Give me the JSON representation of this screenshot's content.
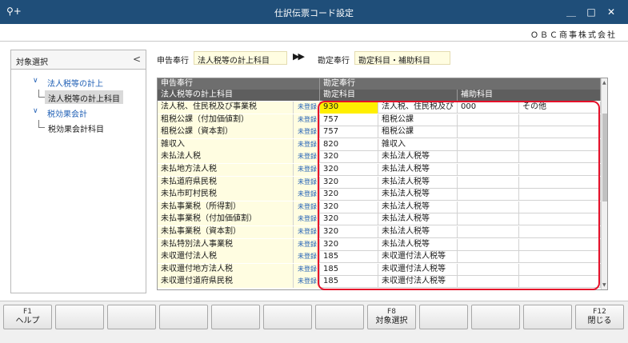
{
  "window": {
    "title": "仕訳伝票コード設定",
    "icon": "search-plus-icon",
    "controls": [
      "minimize-icon",
      "maximize-icon",
      "close-icon"
    ]
  },
  "company": "ＯＢＣ商事株式会社",
  "left_pane": {
    "title": "対象選択",
    "collapse_glyph": "<",
    "tree": [
      {
        "label": "法人税等の計上",
        "type": "parent"
      },
      {
        "label": "法人税等の計上科目",
        "type": "child",
        "selected": true
      },
      {
        "label": "税効果会計",
        "type": "parent"
      },
      {
        "label": "税効果会計科目",
        "type": "child",
        "selected": false
      }
    ]
  },
  "header": {
    "declaration_label": "申告奉行",
    "declaration_value": "法人税等の計上科目",
    "arrows": "▶▶",
    "kanjo_label": "勘定奉行",
    "kanjo_value": "勘定科目・補助科目"
  },
  "grid": {
    "top_headers": [
      "申告奉行",
      "勘定奉行"
    ],
    "sub_headers": [
      "法人税等の計上科目",
      "勘定科目",
      "補助科目"
    ],
    "unregistered_label": "未登録",
    "rows": [
      {
        "name": "法人税、住民税及び事業税",
        "reg": "未登録",
        "code": "930",
        "account": "法人税、住民税及び",
        "sub_code": "000",
        "sub_name": "その他"
      },
      {
        "name": "租税公課（付加価値割）",
        "reg": "未登録",
        "code": "757",
        "account": "租税公課",
        "sub_code": "",
        "sub_name": ""
      },
      {
        "name": "租税公課（資本割）",
        "reg": "未登録",
        "code": "757",
        "account": "租税公課",
        "sub_code": "",
        "sub_name": ""
      },
      {
        "name": "雑収入",
        "reg": "未登録",
        "code": "820",
        "account": "雑収入",
        "sub_code": "",
        "sub_name": ""
      },
      {
        "name": "未払法人税",
        "reg": "未登録",
        "code": "320",
        "account": "未払法人税等",
        "sub_code": "",
        "sub_name": ""
      },
      {
        "name": "未払地方法人税",
        "reg": "未登録",
        "code": "320",
        "account": "未払法人税等",
        "sub_code": "",
        "sub_name": ""
      },
      {
        "name": "未払道府県民税",
        "reg": "未登録",
        "code": "320",
        "account": "未払法人税等",
        "sub_code": "",
        "sub_name": ""
      },
      {
        "name": "未払市町村民税",
        "reg": "未登録",
        "code": "320",
        "account": "未払法人税等",
        "sub_code": "",
        "sub_name": ""
      },
      {
        "name": "未払事業税（所得割）",
        "reg": "未登録",
        "code": "320",
        "account": "未払法人税等",
        "sub_code": "",
        "sub_name": ""
      },
      {
        "name": "未払事業税（付加価値割）",
        "reg": "未登録",
        "code": "320",
        "account": "未払法人税等",
        "sub_code": "",
        "sub_name": ""
      },
      {
        "name": "未払事業税（資本割）",
        "reg": "未登録",
        "code": "320",
        "account": "未払法人税等",
        "sub_code": "",
        "sub_name": ""
      },
      {
        "name": "未払特別法人事業税",
        "reg": "未登録",
        "code": "320",
        "account": "未払法人税等",
        "sub_code": "",
        "sub_name": ""
      },
      {
        "name": "未収還付法人税",
        "reg": "未登録",
        "code": "185",
        "account": "未収還付法人税等",
        "sub_code": "",
        "sub_name": ""
      },
      {
        "name": "未収還付地方法人税",
        "reg": "未登録",
        "code": "185",
        "account": "未収還付法人税等",
        "sub_code": "",
        "sub_name": ""
      },
      {
        "name": "未収還付道府県民税",
        "reg": "未登録",
        "code": "185",
        "account": "未収還付法人税等",
        "sub_code": "",
        "sub_name": ""
      }
    ]
  },
  "function_keys": [
    {
      "key": "F1",
      "label": "ヘルプ"
    },
    {
      "key": "",
      "label": ""
    },
    {
      "key": "",
      "label": ""
    },
    {
      "key": "",
      "label": ""
    },
    {
      "key": "",
      "label": ""
    },
    {
      "key": "",
      "label": ""
    },
    {
      "key": "",
      "label": ""
    },
    {
      "key": "F8",
      "label": "対象選択"
    },
    {
      "key": "",
      "label": ""
    },
    {
      "key": "",
      "label": ""
    },
    {
      "key": "",
      "label": ""
    },
    {
      "key": "F12",
      "label": "閉じる"
    }
  ],
  "colors": {
    "titlebar": "#1f4e79",
    "input_bg": "#fffde1",
    "selected_cell": "#ffef00",
    "highlight_border": "#e5102a",
    "link_blue": "#1f5fb5"
  }
}
